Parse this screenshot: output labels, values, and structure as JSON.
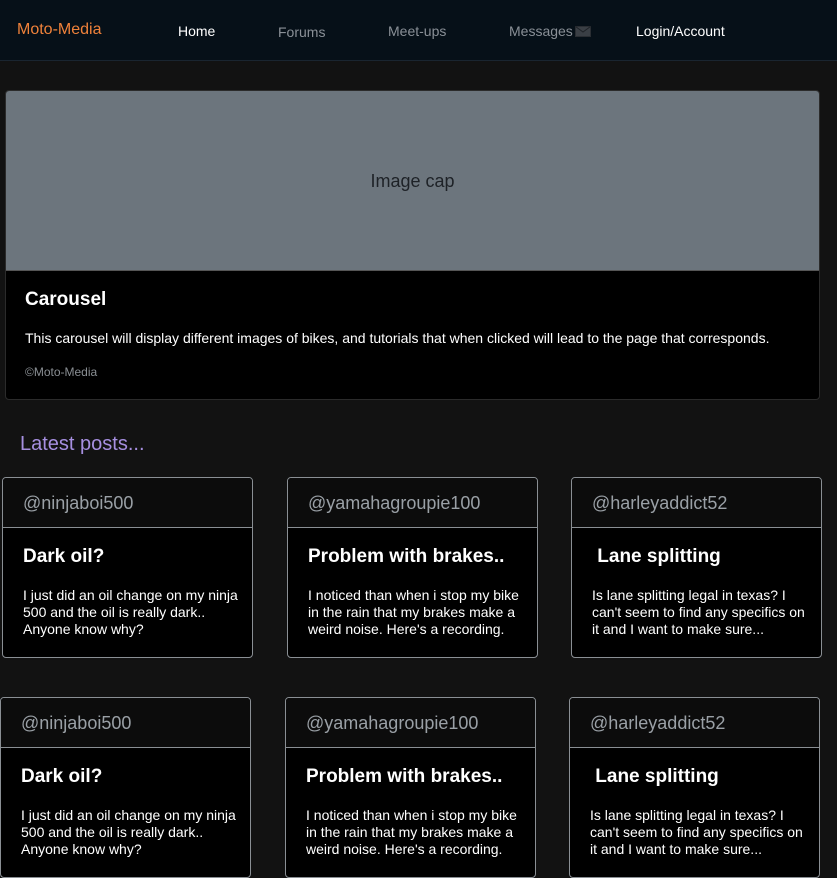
{
  "nav": {
    "brand": "Moto-Media",
    "home": "Home",
    "forums": "Forums",
    "meetups": "Meet-ups",
    "messages": "Messages",
    "login": "Login/Account"
  },
  "carousel": {
    "image_cap": "Image cap",
    "title": "Carousel",
    "text": "This carousel will display different images of bikes, and tutorials that when clicked will lead to the page that corresponds.",
    "copyright": "©Moto-Media"
  },
  "latest": {
    "heading": "Latest posts..."
  },
  "posts": [
    {
      "user": "@ninjaboi500",
      "title": "Dark oil?",
      "body": "I just did an oil change on my ninja 500 and the oil is really dark.. Anyone know why?"
    },
    {
      "user": "@yamahagroupie100",
      "title": "Problem with brakes..",
      "body": "I noticed than when i stop my bike in the rain that my brakes make a weird noise. Here's a recording."
    },
    {
      "user": "@harleyaddict52",
      "title": " Lane splitting",
      "body": "Is lane splitting legal in texas? I can't seem to find any specifics on it and I want to make sure..."
    },
    {
      "user": "@ninjaboi500",
      "title": "Dark oil?",
      "body": "I just did an oil change on my ninja 500 and the oil is really dark.. Anyone know why?"
    },
    {
      "user": "@yamahagroupie100",
      "title": "Problem with brakes..",
      "body": "I noticed than when i stop my bike in the rain that my brakes make a weird noise. Here's a recording."
    },
    {
      "user": "@harleyaddict52",
      "title": " Lane splitting",
      "body": "Is lane splitting legal in texas? I can't seem to find any specifics on it and I want to make sure..."
    }
  ],
  "colors": {
    "brand": "#f0823a",
    "heading_accent": "#a68fe0",
    "image_placeholder": "#6c757d"
  },
  "icons": {
    "messages": "envelope-icon"
  }
}
